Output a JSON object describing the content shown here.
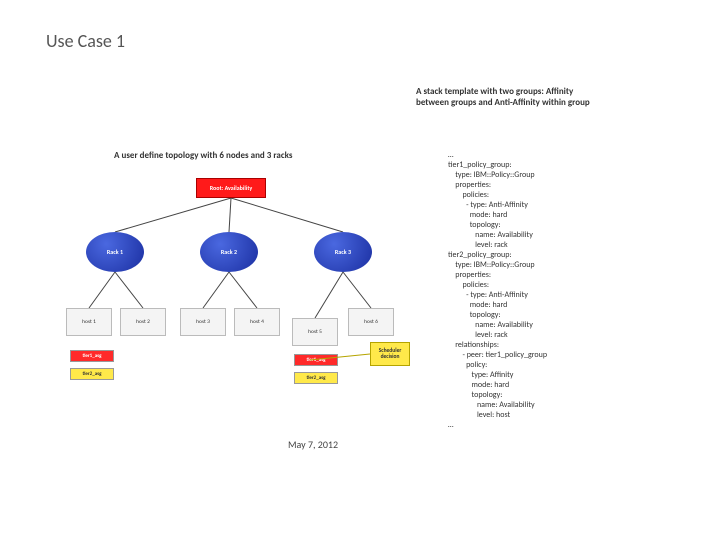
{
  "title": "Use Case 1",
  "description": "A stack template with two groups:\nAffinity between groups and Anti-Affinity within group",
  "caption": "A user define topology with 6 nodes and 3 racks",
  "date": "May 7, 2012",
  "diagram": {
    "root": "Root: Availability",
    "racks": [
      "Rack 1",
      "Rack 2",
      "Rack 3"
    ],
    "hosts": [
      "host 1",
      "host 2",
      "host 3",
      "host 4",
      "host 5",
      "host 6"
    ],
    "asg": {
      "top_left": "tier1_asg",
      "bot_left": "tier2_asg",
      "top_right": "tier1_asg",
      "bot_right": "tier2_asg"
    }
  },
  "scheduler": "Scheduler decision",
  "yaml": "…\ntier1_policy_group:\n    type: IBM::Policy::Group\n    properties:\n        policies:\n          - type: Anti-Affinity\n            mode: hard\n            topology:\n               name: Availability\n               level: rack\ntier2_policy_group:\n    type: IBM::Policy::Group\n    properties:\n        policies:\n          - type: Anti-Affinity\n            mode: hard\n            topology:\n               name: Availability\n               level: rack\n    relationships:\n        - peer: tier1_policy_group\n          policy:\n             type: Affinity\n             mode: hard\n             topology:\n                name: Availability\n                level: host\n…"
}
